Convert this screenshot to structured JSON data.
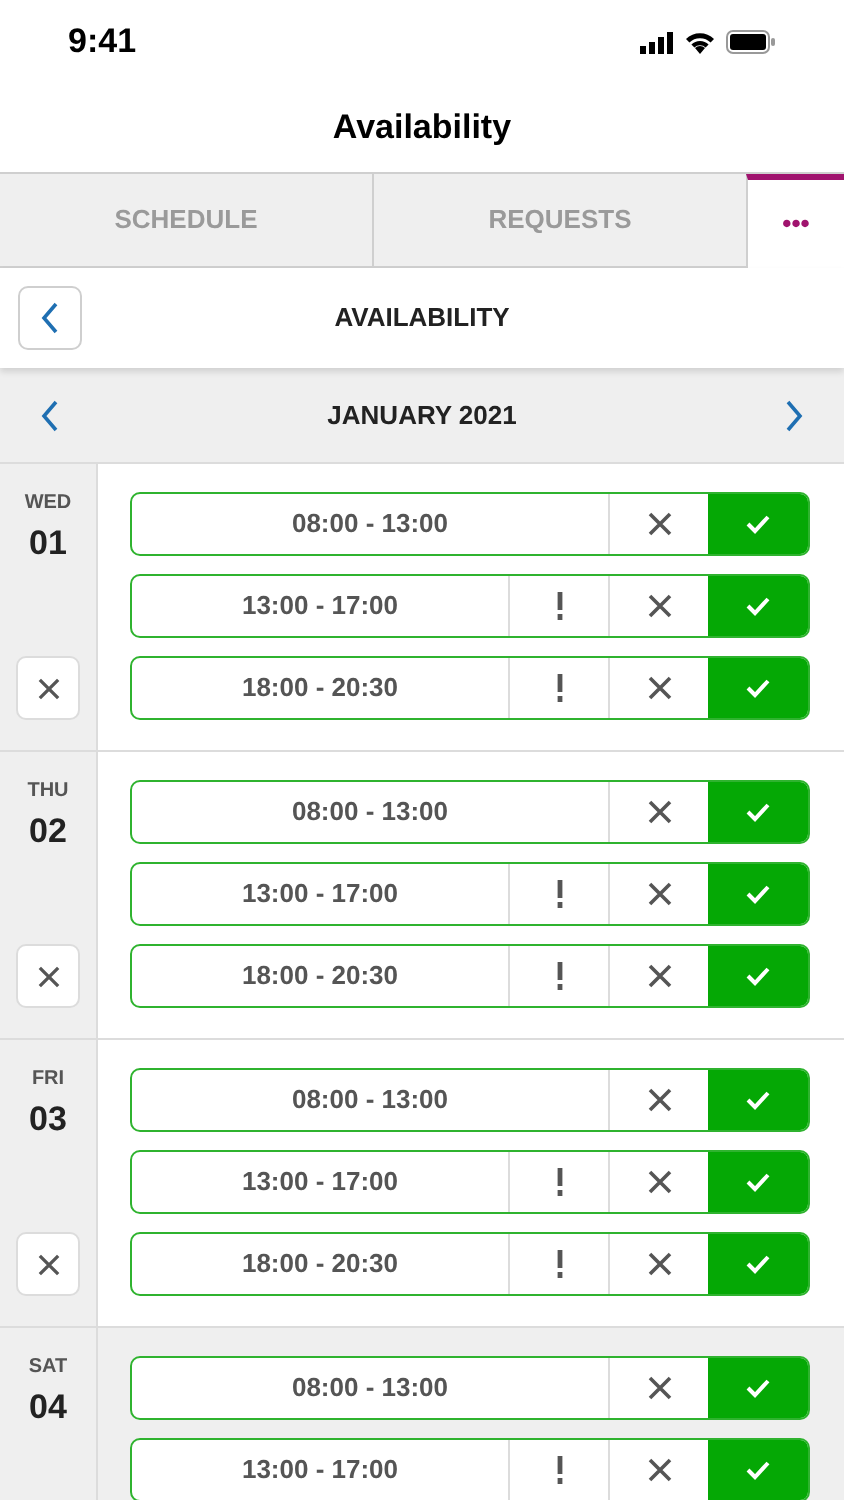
{
  "status_bar": {
    "time": "9:41"
  },
  "title": "Availability",
  "tabs": [
    {
      "label": "SCHEDULE",
      "selected": false
    },
    {
      "label": "REQUESTS",
      "selected": false
    },
    {
      "label": "•••",
      "selected": true
    }
  ],
  "header": {
    "title": "AVAILABILITY"
  },
  "month": "JANUARY 2021",
  "days": [
    {
      "weekday": "WED",
      "date": "01",
      "shaded": false,
      "clear_button": true,
      "slots": [
        {
          "time": "08:00 - 13:00",
          "warning": false,
          "accepted": true
        },
        {
          "time": "13:00 - 17:00",
          "warning": true,
          "accepted": true
        },
        {
          "time": "18:00 - 20:30",
          "warning": true,
          "accepted": true
        }
      ]
    },
    {
      "weekday": "THU",
      "date": "02",
      "shaded": false,
      "clear_button": true,
      "slots": [
        {
          "time": "08:00 - 13:00",
          "warning": false,
          "accepted": true
        },
        {
          "time": "13:00 - 17:00",
          "warning": true,
          "accepted": true
        },
        {
          "time": "18:00 - 20:30",
          "warning": true,
          "accepted": true
        }
      ]
    },
    {
      "weekday": "FRI",
      "date": "03",
      "shaded": false,
      "clear_button": true,
      "slots": [
        {
          "time": "08:00 - 13:00",
          "warning": false,
          "accepted": true
        },
        {
          "time": "13:00 - 17:00",
          "warning": true,
          "accepted": true
        },
        {
          "time": "18:00 - 20:30",
          "warning": true,
          "accepted": true
        }
      ]
    },
    {
      "weekday": "SAT",
      "date": "04",
      "shaded": true,
      "clear_button": false,
      "slots": [
        {
          "time": "08:00 - 13:00",
          "warning": false,
          "accepted": true
        },
        {
          "time": "13:00 - 17:00",
          "warning": true,
          "accepted": true
        }
      ]
    }
  ]
}
